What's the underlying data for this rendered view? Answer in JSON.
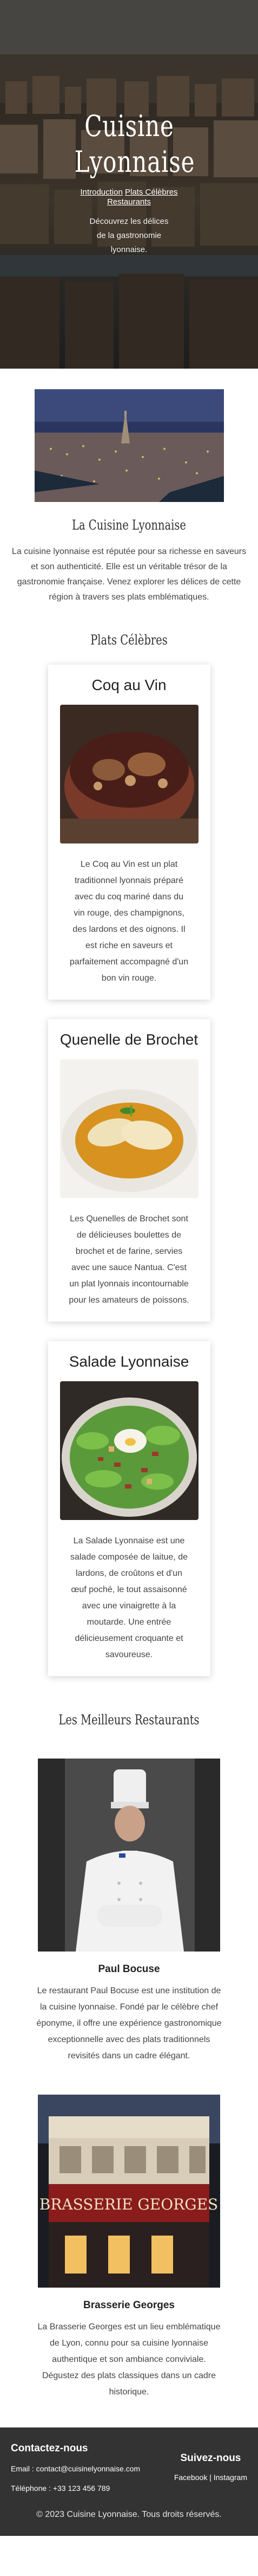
{
  "hero": {
    "title": "Cuisine Lyonnaise",
    "nav": [
      "Introduction",
      "Plats Célèbres",
      "Restaurants"
    ],
    "tagline": "Découvrez les délices de la gastronomie lyonnaise."
  },
  "about": {
    "title": "La Cuisine Lyonnaise",
    "text": "La cuisine lyonnaise est réputée pour sa richesse en saveurs et son authenticité. Elle est un véritable trésor de la gastronomie française. Venez explorer les délices de cette région à travers ses plats emblématiques."
  },
  "dishes": {
    "title": "Plats Célèbres",
    "items": [
      {
        "name": "Coq au Vin",
        "description": "Le Coq au Vin est un plat traditionnel lyonnais préparé avec du coq mariné dans du vin rouge, des champignons, des lardons et des oignons. Il est riche en saveurs et parfaitement accompagné d'un bon vin rouge."
      },
      {
        "name": "Quenelle de Brochet",
        "description": "Les Quenelles de Brochet sont de délicieuses boulettes de brochet et de farine, servies avec une sauce Nantua. C'est un plat lyonnais incontournable pour les amateurs de poissons."
      },
      {
        "name": "Salade Lyonnaise",
        "description": "La Salade Lyonnaise est une salade composée de laitue, de lardons, de croûtons et d'un œuf poché, le tout assaisonné avec une vinaigrette à la moutarde. Une entrée délicieusement croquante et savoureuse."
      }
    ]
  },
  "restaurants": {
    "title": "Les Meilleurs Restaurants",
    "items": [
      {
        "name": "Paul Bocuse",
        "description": "Le restaurant Paul Bocuse est une institution de la cuisine lyonnaise. Fondé par le célèbre chef éponyme, il offre une expérience gastronomique exceptionnelle avec des plats traditionnels revisités dans un cadre élégant."
      },
      {
        "name": "Brasserie Georges",
        "description": "La Brasserie Georges est un lieu emblématique de Lyon, connu pour sa cuisine lyonnaise authentique et son ambiance conviviale. Dégustez des plats classiques dans un cadre historique.",
        "sign_text": "BRASSERIE GEORGES"
      }
    ]
  },
  "footer": {
    "contact_title": "Contactez-nous",
    "email": "Email : contact@cuisinelyonnaise.com",
    "phone": "Téléphone : +33 123 456 789",
    "follow_title": "Suivez-nous",
    "social_facebook": "Facebook",
    "social_separator": "|",
    "social_instagram": "Instagram",
    "copyright": "© 2023 Cuisine Lyonnaise. Tous droits réservés."
  }
}
